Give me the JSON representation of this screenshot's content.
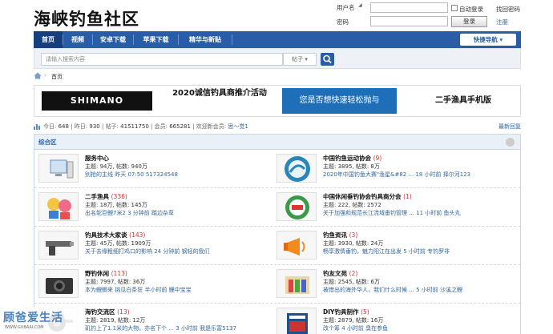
{
  "site": {
    "logo_text": "海峡钓鱼社区"
  },
  "login": {
    "username_label": "用户名",
    "password_label": "密码",
    "auto_login": "自动登录",
    "forgot": "找回密码",
    "login_button": "登录",
    "register": "注册"
  },
  "nav": {
    "items": [
      "首页",
      "视频",
      "安卓下载",
      "苹果下载",
      "精华与新贴"
    ],
    "quick_nav": "快捷导航"
  },
  "search": {
    "placeholder": "请输入搜索内容",
    "scope": "帖子"
  },
  "breadcrumb": {
    "current": "首页"
  },
  "banners": {
    "b1": "SHIMANO",
    "b2": "2020诚信钓具商推介活动",
    "b3": "您是否想快速轻松抛与",
    "b4": "二手渔具手机版"
  },
  "stats": {
    "today_label": "今日:",
    "today": "648",
    "yesterday_label": "昨日:",
    "yesterday": "930",
    "posts_label": "帖子:",
    "posts": "41511750",
    "members_label": "会员:",
    "members": "665281",
    "welcome_label": "欢迎新会员:",
    "new_member": "思～觉1",
    "latest_reply": "最新回复"
  },
  "zone": {
    "title": "综合区"
  },
  "forums": [
    {
      "name": "服务中心",
      "count": "",
      "stats": "主题: 94万, 帖数: 940万",
      "last": "别抢的主线 昨天 07:50 517324548",
      "icon": "computer-icon"
    },
    {
      "name": "中国钓鱼运动协会",
      "count": "(9)",
      "stats": "主题: 3895, 帖数: 8万",
      "last": "2020年中国钓鱼大赛\"渔星&#82 ... 18 小时前 择尔河123",
      "icon": "association-logo-icon"
    },
    {
      "name": "二手渔具",
      "count": "(336)",
      "stats": "主题: 18万, 帖数: 145万",
      "last": "出名鸵巨鲤7米2 3 分钟前 踏边杂草",
      "icon": "mascot-icon"
    },
    {
      "name": "中国休闲垂钓协会钓具商分会",
      "count": "(1)",
      "stats": "主题: 222, 帖数: 2572",
      "last": "关于加强和规范长江流域垂钓管理 ... 11 小时前 鱼头丸",
      "icon": "badge-icon"
    },
    {
      "name": "钓具技术大家谈",
      "count": "(143)",
      "stats": "主题: 45万, 帖数: 1909万",
      "last": "关于去缘粗细打鸡口的影响 24 分钟前 钢轻的我们",
      "icon": "gun-icon"
    },
    {
      "name": "钓鱼资讯",
      "count": "(3)",
      "stats": "主题: 3930, 帖数: 24万",
      "last": "畅享激情垂钓，魅力阳江在出发 5 小时前 专钓罗非",
      "icon": "megaphone-icon"
    },
    {
      "name": "野钓休闲",
      "count": "(113)",
      "stats": "主题: 7997, 帖数: 36万",
      "last": "本为鲤鲫来 挑见白条狂 半小时前 鲤中宝宝",
      "icon": "camera-icon"
    },
    {
      "name": "钓友文苑",
      "count": "(2)",
      "stats": "主题: 2545, 帖数: 6万",
      "last": "被借出的海外华人，我们什么时候 ... 5 小时前 沙溪之鲤",
      "icon": "pens-icon"
    },
    {
      "name": "海钓交流区",
      "count": "(13)",
      "stats": "主题: 2819, 帖数: 12万",
      "last": "矶钓上了1.1米的大物，亦名下个 ... 3 小时前 我是乐富5137",
      "icon": "reel-icon"
    },
    {
      "name": "DIY钓具制作",
      "count": "(5)",
      "stats": "主题: 2879, 帖数: 16万",
      "last": "改个筹 4 小时前 臭在参鱼",
      "icon": "book-icon"
    }
  ],
  "watermark": {
    "big": "顾爸爱生活",
    "small": "WWW.GUBAAI.COM"
  },
  "colors": {
    "nav": "#2a5da8",
    "nav_active": "#163f7d",
    "link": "#336699",
    "count": "#cc3333"
  }
}
